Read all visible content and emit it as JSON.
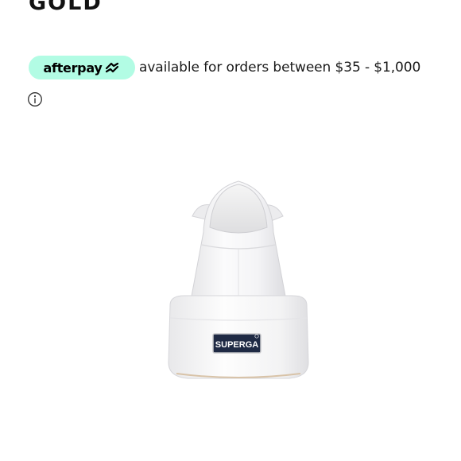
{
  "product": {
    "title": "GOLD",
    "image_alt": "White Superga platform sneaker, rear view",
    "heel_tab_brand": "SUPERGA"
  },
  "afterpay": {
    "badge_label": "afterpay",
    "message": "available for orders between $35 - $1,000",
    "badge_color": "#b2fce4",
    "logo_icon": "afterpay-arrows-icon",
    "info_icon": "info-icon"
  }
}
